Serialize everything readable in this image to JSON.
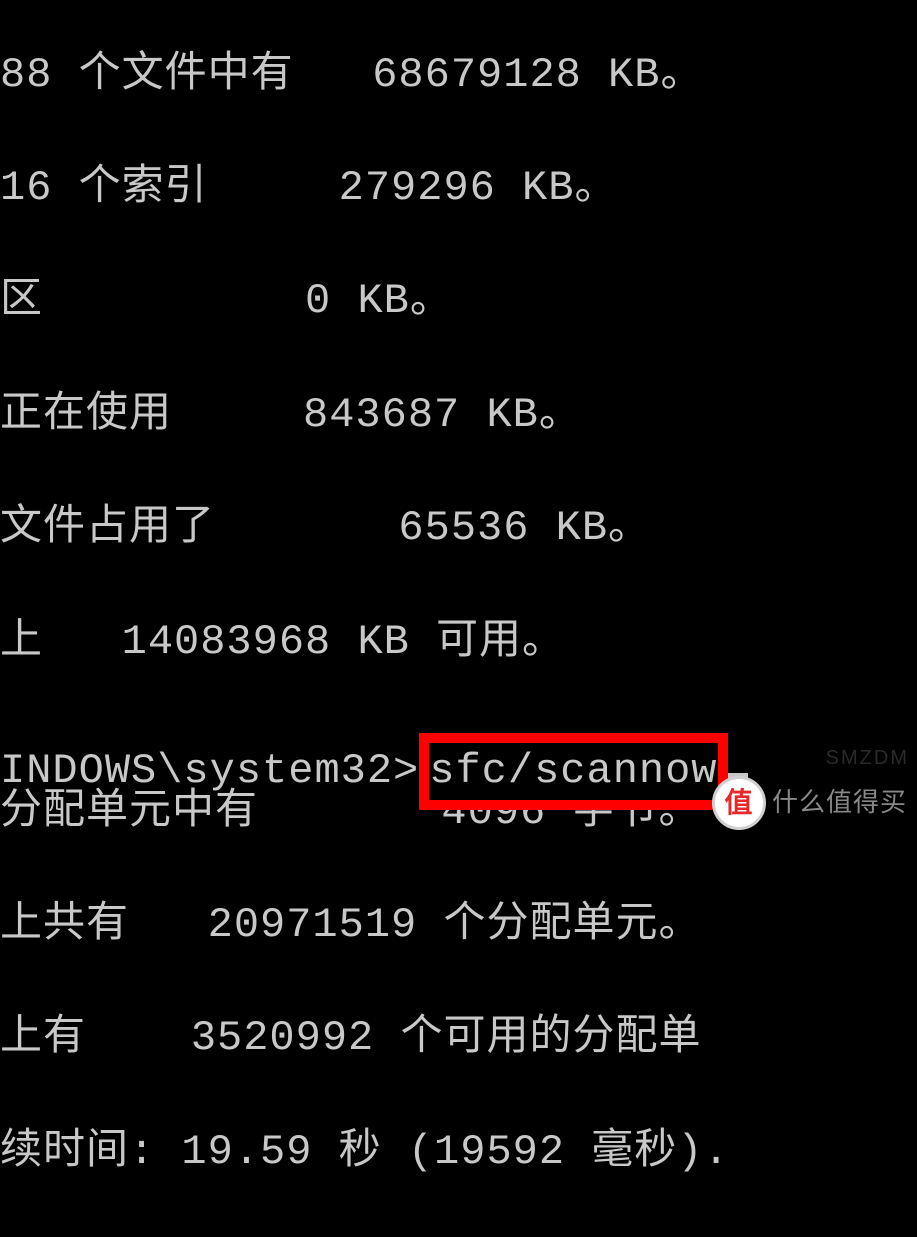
{
  "output": {
    "lines": [
      "88 个文件中有   68679128 KB。",
      "16 个索引     279296 KB。",
      "区          0 KB。",
      "正在使用     843687 KB。",
      "文件占用了       65536 KB。",
      "上   14083968 KB 可用。",
      "",
      "分配单元中有       4096 字节。",
      "上共有   20971519 个分配单元。",
      "上有    3520992 个可用的分配单",
      "续时间: 19.59 秒 (19592 毫秒)."
    ]
  },
  "prompt": {
    "path": "INDOWS\\system32>",
    "command": "sfc/scannow"
  },
  "watermark": {
    "badge_char": "值",
    "badge_label": "什么值得买",
    "corner": "SMZDM"
  }
}
